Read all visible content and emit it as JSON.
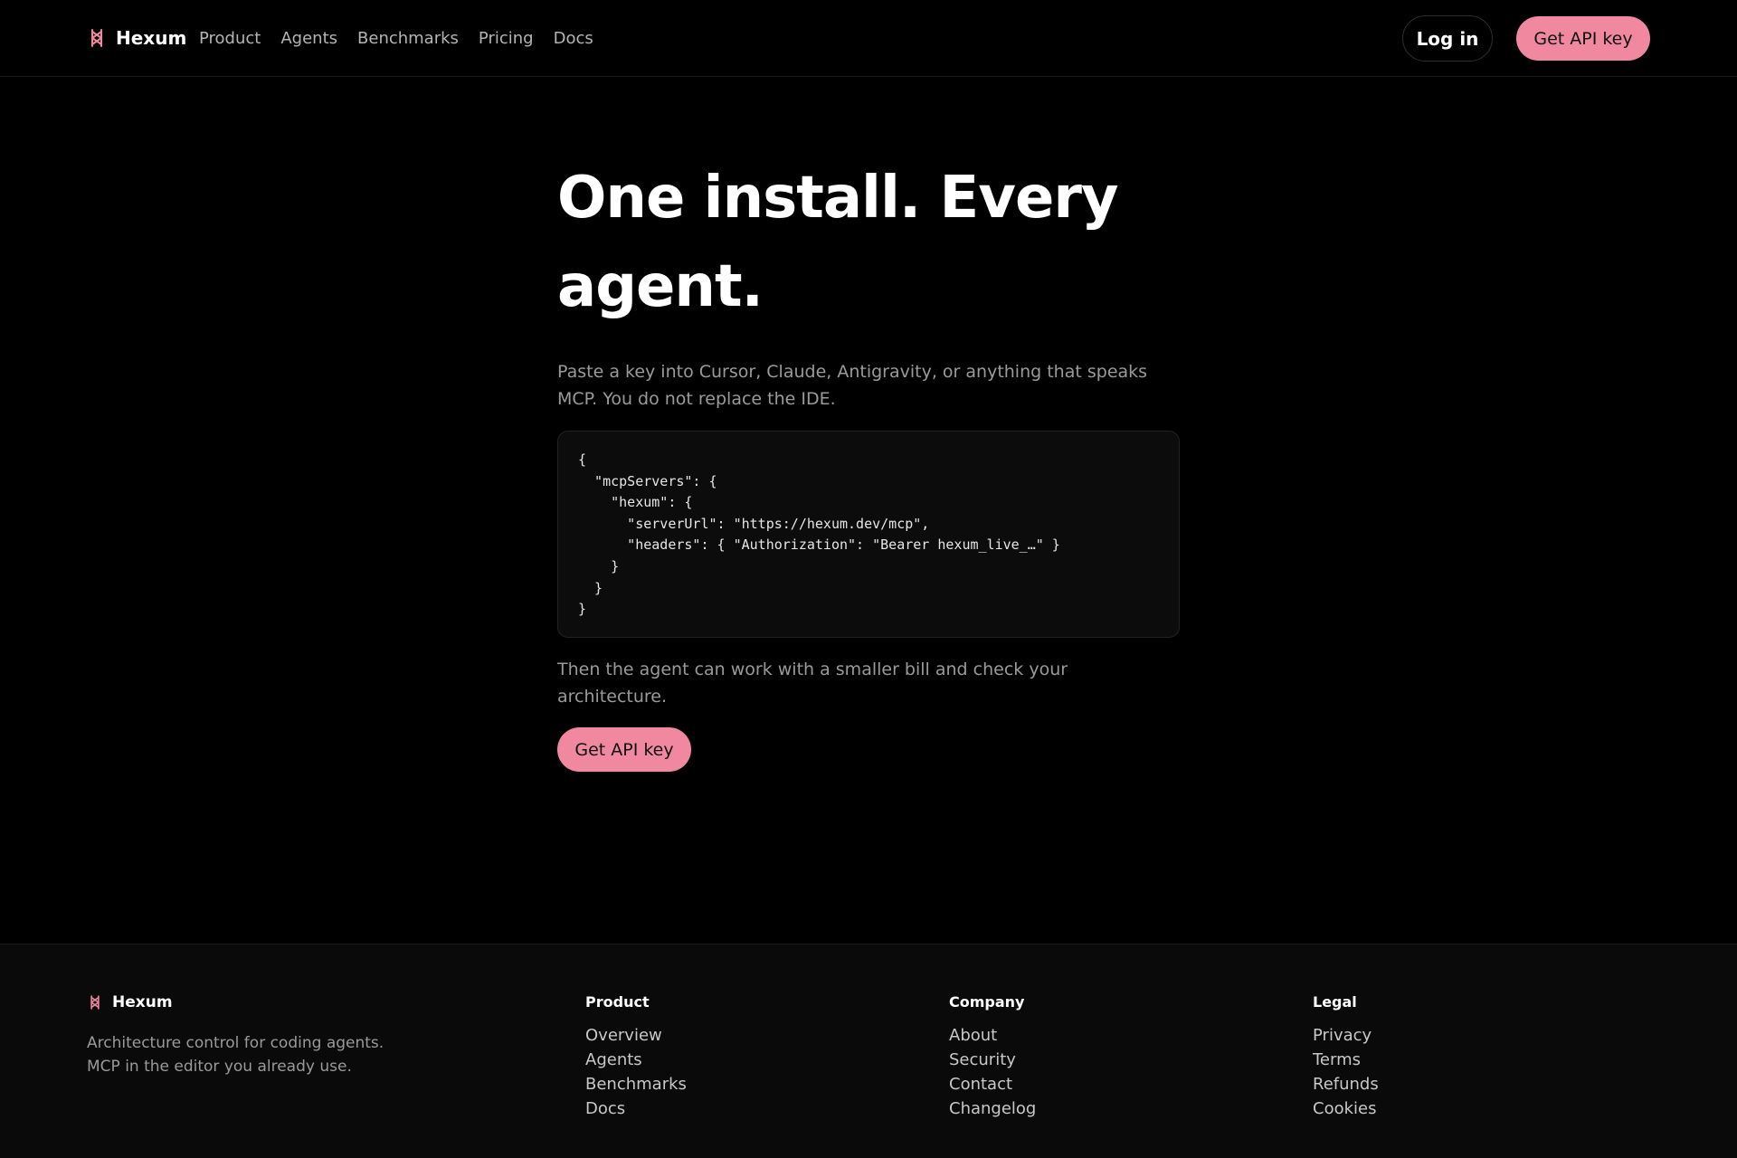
{
  "header": {
    "brand": "Hexum",
    "nav": [
      "Product",
      "Agents",
      "Benchmarks",
      "Pricing",
      "Docs"
    ],
    "login": "Log in",
    "cta": "Get API key"
  },
  "hero": {
    "headline_line1": "One install. Every",
    "headline_line2": "agent.",
    "lead": "Paste a key into Cursor, Claude, Antigravity, or anything that speaks MCP. You do not replace the IDE.",
    "code": "{\n  \"mcpServers\": {\n    \"hexum\": {\n      \"serverUrl\": \"https://hexum.dev/mcp\",\n      \"headers\": { \"Authorization\": \"Bearer hexum_live_…\" }\n    }\n  }\n}",
    "after": "Then the agent can work with a smaller bill and check your architecture.",
    "cta": "Get API key"
  },
  "footer": {
    "brand": "Hexum",
    "tagline_line1": "Architecture control for coding agents.",
    "tagline_line2": "MCP in the editor you already use.",
    "columns": [
      {
        "title": "Product",
        "links": [
          "Overview",
          "Agents",
          "Benchmarks",
          "Docs"
        ]
      },
      {
        "title": "Company",
        "links": [
          "About",
          "Security",
          "Contact",
          "Changelog"
        ]
      },
      {
        "title": "Legal",
        "links": [
          "Privacy",
          "Terms",
          "Refunds",
          "Cookies"
        ]
      }
    ]
  },
  "colors": {
    "accent": "#f088a0",
    "background": "#000000",
    "footer_bg": "#0a0a0a",
    "muted_text": "#9a9a9a"
  },
  "icons": {
    "brand": "hexum-logo-icon"
  }
}
